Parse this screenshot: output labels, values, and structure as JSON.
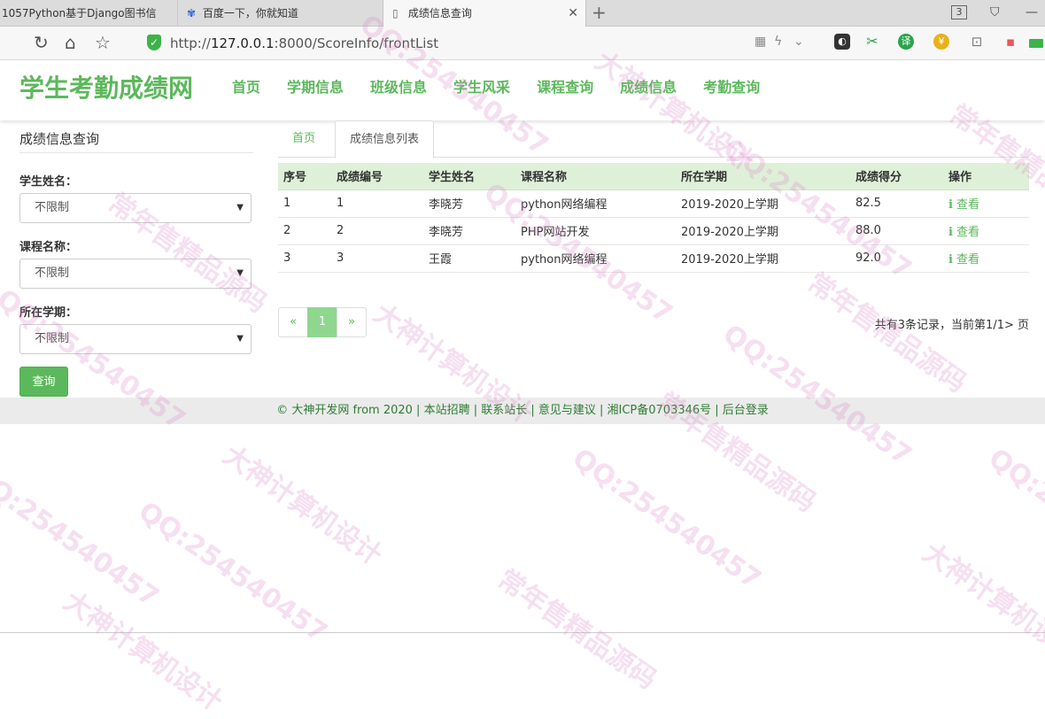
{
  "browser": {
    "tabs": [
      {
        "title": "1057Python基于Django图书信"
      },
      {
        "title": "百度一下，你就知道"
      },
      {
        "title": "成绩信息查询"
      }
    ],
    "new_tab": "+",
    "tab_count": "3",
    "url_prefix": "http://",
    "url_host": "127.0.0.1",
    "url_rest": ":8000/ScoreInfo/frontList"
  },
  "site": {
    "brand": "学生考勤成绩网",
    "nav": [
      "首页",
      "学期信息",
      "班级信息",
      "学生风采",
      "课程查询",
      "成绩信息",
      "考勤查询"
    ]
  },
  "search": {
    "title": "成绩信息查询",
    "student_label": "学生姓名：",
    "student_value": "不限制",
    "course_label": "课程名称：",
    "course_value": "不限制",
    "term_label": "所在学期：",
    "term_value": "不限制",
    "submit": "查询"
  },
  "content": {
    "tab_home": "首页",
    "tab_list": "成绩信息列表",
    "columns": [
      "序号",
      "成绩编号",
      "学生姓名",
      "课程名称",
      "所在学期",
      "成绩得分",
      "操作"
    ],
    "rows": [
      {
        "no": "1",
        "id": "1",
        "student": "李晓芳",
        "course": "python网络编程",
        "term": "2019-2020上学期",
        "score": "82.5",
        "action": "查看"
      },
      {
        "no": "2",
        "id": "2",
        "student": "李晓芳",
        "course": "PHP网站开发",
        "term": "2019-2020上学期",
        "score": "88.0",
        "action": "查看"
      },
      {
        "no": "3",
        "id": "3",
        "student": "王霞",
        "course": "python网络编程",
        "term": "2019-2020上学期",
        "score": "92.0",
        "action": "查看"
      }
    ],
    "pager": {
      "prev": "«",
      "current": "1",
      "next": "»"
    },
    "record_info": "共有3条记录，当前第1/1> 页"
  },
  "footer": {
    "text": "© 大神开发网 from 2020 | 本站招聘 | 联系站长 | 意见与建议 | 湘ICP备0703346号 | 后台登录"
  },
  "watermarks": [
    "QQ:254540457",
    "大神计算机设计",
    "常年售精品源码"
  ],
  "colors": {
    "accent": "#5cb85c",
    "table_header": "#dff0d8",
    "footer_bg": "#ebebeb"
  }
}
